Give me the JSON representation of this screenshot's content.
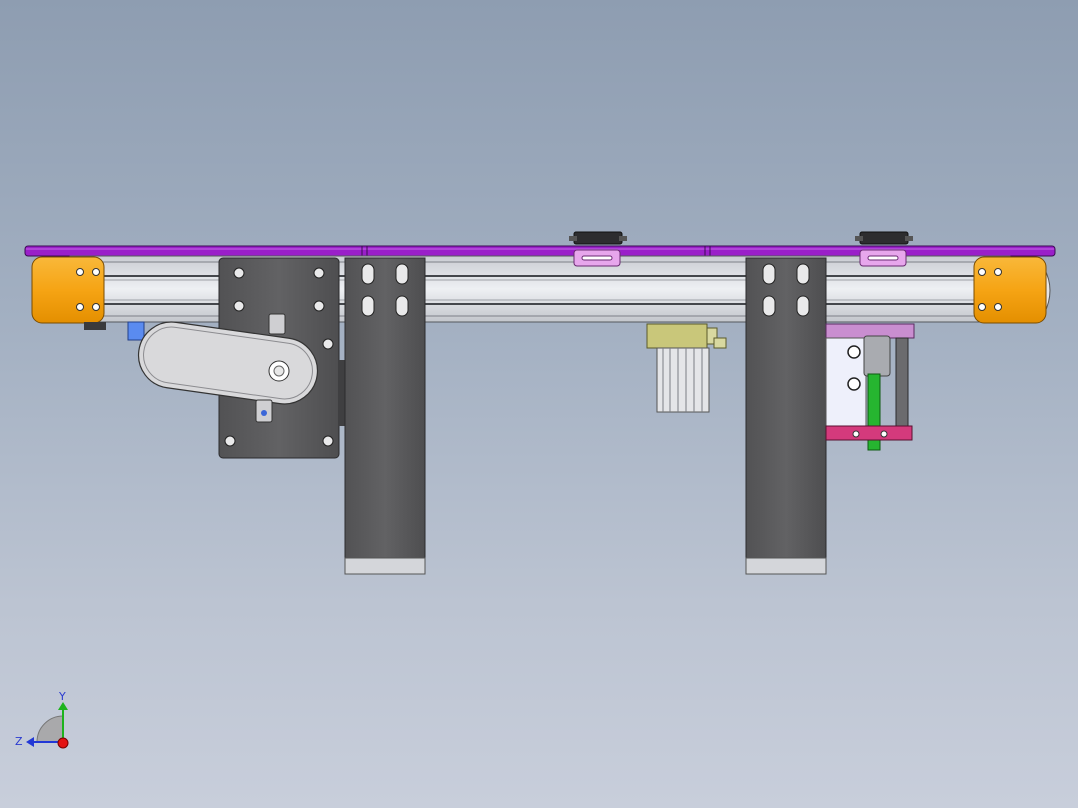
{
  "view": {
    "background_top": "#8e9db1",
    "background_bottom": "#c8cedb"
  },
  "colors": {
    "belt": "#9a1fc9",
    "end_caps": "#f6a414",
    "frame_rail": "#d8dbe1",
    "plates": "#5c5c5e",
    "sensor_brackets": "#e7a6ec",
    "cylinder_yellow": "#c9c77a",
    "stopper_base": "#d43a7c",
    "stopper_rod": "#26b530",
    "motor_cover": "#d9d9db",
    "motor_block": "#5a8bf0"
  },
  "triad": {
    "y_label": "Y",
    "z_label": "Z",
    "y_axis_color": "#1db31d",
    "z_axis_color": "#2238d6",
    "x_axis_color": "#e31212"
  }
}
